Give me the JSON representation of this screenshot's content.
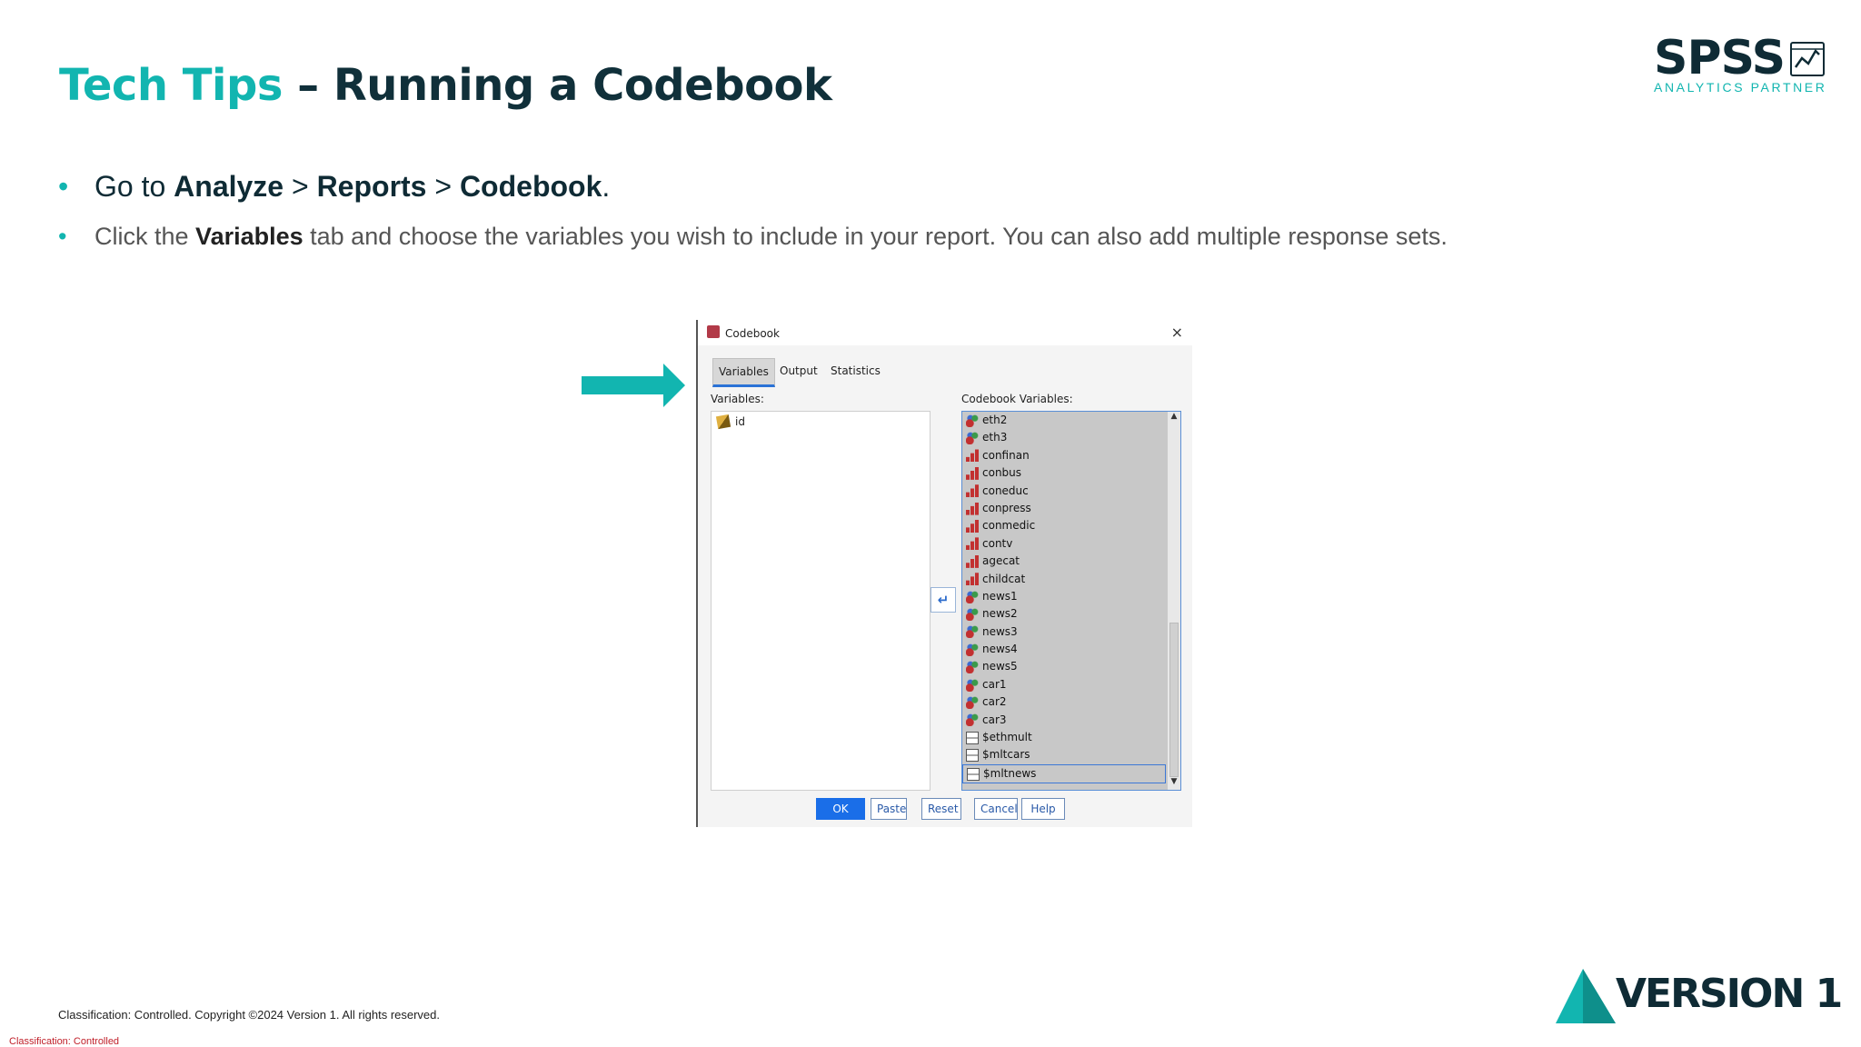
{
  "slide": {
    "title_accent": "Tech Tips",
    "title_rest": " – Running a Codebook",
    "bullets": [
      {
        "pre": "Go to ",
        "b1": "Analyze",
        "m1": " > ",
        "b2": "Reports",
        "m2": " > ",
        "b3": "Codebook",
        "post": "."
      },
      {
        "pre": "Click the ",
        "b1": "Variables",
        "post": " tab and choose the variables you wish to include in your report. You can also add multiple response sets."
      }
    ],
    "bullet_char": "•",
    "footer_copyright": "Classification: Controlled. Copyright ©2024 Version 1. All rights reserved.",
    "footer_classification": "Classification: Controlled",
    "logo_spss": {
      "word": "SPSS",
      "sub": "ANALYTICS PARTNER"
    },
    "logo_version1": {
      "word": "VERSION 1"
    },
    "colors": {
      "accent": "#12b5b0",
      "dark": "#0f2b35",
      "classification": "#c0202a"
    }
  },
  "dialog": {
    "title": "Codebook",
    "close_glyph": "×",
    "tabs": [
      "Variables",
      "Output",
      "Statistics"
    ],
    "active_tab": "Variables",
    "source_label": "Variables:",
    "target_label": "Codebook Variables:",
    "source_items": [
      {
        "name": "id",
        "icon": "scale-pencil-icon"
      }
    ],
    "move_glyph": "↵",
    "target_items": [
      {
        "name": "eth2",
        "icon": "nominal"
      },
      {
        "name": "eth3",
        "icon": "nominal"
      },
      {
        "name": "confinan",
        "icon": "ordinal"
      },
      {
        "name": "conbus",
        "icon": "ordinal"
      },
      {
        "name": "coneduc",
        "icon": "ordinal"
      },
      {
        "name": "conpress",
        "icon": "ordinal"
      },
      {
        "name": "conmedic",
        "icon": "ordinal"
      },
      {
        "name": "contv",
        "icon": "ordinal"
      },
      {
        "name": "agecat",
        "icon": "ordinal"
      },
      {
        "name": "childcat",
        "icon": "ordinal"
      },
      {
        "name": "news1",
        "icon": "nominal"
      },
      {
        "name": "news2",
        "icon": "nominal"
      },
      {
        "name": "news3",
        "icon": "nominal"
      },
      {
        "name": "news4",
        "icon": "nominal"
      },
      {
        "name": "news5",
        "icon": "nominal"
      },
      {
        "name": "car1",
        "icon": "nominal"
      },
      {
        "name": "car2",
        "icon": "nominal"
      },
      {
        "name": "car3",
        "icon": "nominal"
      },
      {
        "name": "$ethmult",
        "icon": "mrset"
      },
      {
        "name": "$mltcars",
        "icon": "mrset"
      },
      {
        "name": "$mltnews",
        "icon": "mrset"
      }
    ],
    "selected_target": "$mltnews",
    "buttons": [
      "OK",
      "Paste",
      "Reset",
      "Cancel",
      "Help"
    ]
  }
}
